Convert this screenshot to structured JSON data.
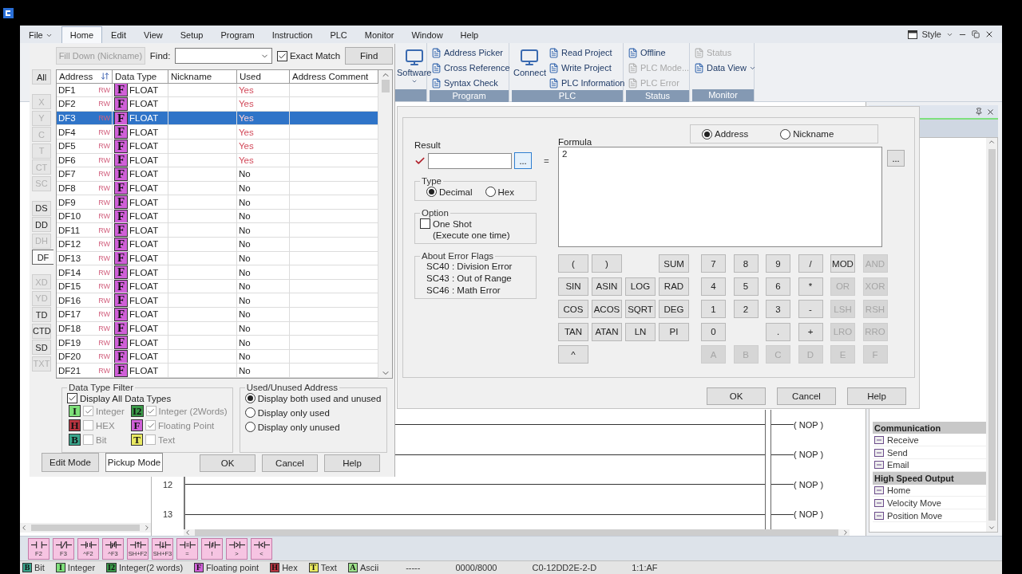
{
  "menu_bar": {
    "items": [
      {
        "label": "File",
        "caret": true,
        "selected": false
      },
      {
        "label": "Home",
        "caret": false,
        "selected": true
      },
      {
        "label": "Edit",
        "caret": false,
        "selected": false
      },
      {
        "label": "View",
        "caret": false,
        "selected": false
      },
      {
        "label": "Setup",
        "caret": false,
        "selected": false
      },
      {
        "label": "Program",
        "caret": false,
        "selected": false
      },
      {
        "label": "Instruction",
        "caret": false,
        "selected": false
      },
      {
        "label": "PLC",
        "caret": false,
        "selected": false
      },
      {
        "label": "Monitor",
        "caret": false,
        "selected": false
      },
      {
        "label": "Window",
        "caret": false,
        "selected": false
      },
      {
        "label": "Help",
        "caret": false,
        "selected": false
      }
    ],
    "style_label": "Style"
  },
  "ribbon": {
    "groups": [
      {
        "kind": "large",
        "items": [
          {
            "label": "Software",
            "caret": true,
            "disabled": false
          }
        ]
      },
      {
        "kind": "small",
        "title": "Program",
        "items": [
          {
            "label": "Address Picker",
            "caret": false,
            "disabled": false
          },
          {
            "label": "Cross Reference",
            "caret": false,
            "disabled": false
          },
          {
            "label": "Syntax Check",
            "caret": false,
            "disabled": false
          }
        ]
      },
      {
        "kind": "mixed",
        "title": "PLC",
        "items": [
          {
            "label": "Connect",
            "caret": false,
            "disabled": false
          },
          {
            "label": "Read Project",
            "caret": false,
            "disabled": false
          },
          {
            "label": "Write Project",
            "caret": false,
            "disabled": false
          },
          {
            "label": "PLC Information",
            "caret": false,
            "disabled": false
          }
        ]
      },
      {
        "kind": "small",
        "title": "Status",
        "items": [
          {
            "label": "Offline",
            "caret": false,
            "disabled": false
          },
          {
            "label": "PLC Mode...",
            "caret": false,
            "disabled": true
          },
          {
            "label": "PLC Error",
            "caret": false,
            "disabled": true
          }
        ]
      },
      {
        "kind": "small",
        "title": "Monitor",
        "items": [
          {
            "label": "Status",
            "caret": false,
            "disabled": true
          },
          {
            "label": "Data View",
            "caret": true,
            "disabled": false
          }
        ]
      }
    ]
  },
  "ladder": {
    "rungs": [
      {
        "output": "( NOP )"
      },
      {
        "output": "( NOP )"
      },
      {
        "number": "12",
        "output": "( NOP )"
      },
      {
        "number": "13",
        "output": "( NOP )"
      }
    ]
  },
  "instruction_list": {
    "items": [
      {
        "kind": "header",
        "label": "Communication"
      },
      {
        "kind": "item",
        "label": "Receive"
      },
      {
        "kind": "item",
        "label": "Send"
      },
      {
        "kind": "item",
        "label": "Email"
      },
      {
        "kind": "header",
        "label": "High Speed Output"
      },
      {
        "kind": "item",
        "label": "Home"
      },
      {
        "kind": "item",
        "label": "Velocity Move"
      },
      {
        "kind": "item",
        "label": "Position Move"
      }
    ]
  },
  "contact_toolbar": [
    {
      "kind": "no",
      "key": "F2"
    },
    {
      "kind": "nc",
      "key": "F3"
    },
    {
      "kind": "no_edge",
      "key": "^F2"
    },
    {
      "kind": "nc_edge",
      "key": "^F3"
    },
    {
      "kind": "rise",
      "key": "SH+F2"
    },
    {
      "kind": "fall",
      "key": "SH+F3"
    },
    {
      "kind": "eq",
      "key": "="
    },
    {
      "kind": "ne",
      "key": "!"
    },
    {
      "kind": "gt",
      "key": ">"
    },
    {
      "kind": "lt",
      "key": "<"
    }
  ],
  "status_bar": {
    "types": [
      {
        "badge": "B",
        "label": "Bit",
        "color": "#3aa58c"
      },
      {
        "badge": "I",
        "label": "Integer",
        "color": "#7ee07a"
      },
      {
        "badge": "I2",
        "label": "Integer(2 words)",
        "color": "#3a9a48"
      },
      {
        "badge": "F",
        "label": "Floating point",
        "color": "#d060d8"
      },
      {
        "badge": "H",
        "label": "Hex",
        "color": "#b83440"
      },
      {
        "badge": "T",
        "label": "Text",
        "color": "#eaea62"
      },
      {
        "badge": "A",
        "label": "Ascii",
        "color": "#9ee28a"
      }
    ],
    "fields": [
      "-----",
      "0000/8000",
      "C0-12DD2E-2-D",
      "1:1:AF"
    ]
  },
  "address_picker": {
    "fill_down": {
      "label": "Fill Down (Nickname)",
      "disabled": true
    },
    "find_label": "Find:",
    "exact_match": {
      "label": "Exact Match",
      "checked": true
    },
    "find_button": "Find",
    "type_groups": [
      {
        "buttons": [
          {
            "label": "All",
            "disabled": false,
            "selected": false
          }
        ]
      },
      {
        "buttons": [
          {
            "label": "X",
            "disabled": true,
            "selected": false
          },
          {
            "label": "Y",
            "disabled": true,
            "selected": false
          },
          {
            "label": "C",
            "disabled": true,
            "selected": false
          },
          {
            "label": "T",
            "disabled": true,
            "selected": false
          },
          {
            "label": "CT",
            "disabled": true,
            "selected": false
          },
          {
            "label": "SC",
            "disabled": true,
            "selected": false
          }
        ]
      },
      {
        "buttons": [
          {
            "label": "DS",
            "disabled": false,
            "selected": false
          },
          {
            "label": "DD",
            "disabled": false,
            "selected": false
          },
          {
            "label": "DH",
            "disabled": true,
            "selected": false
          },
          {
            "label": "DF",
            "disabled": false,
            "selected": true
          }
        ]
      },
      {
        "buttons": [
          {
            "label": "XD",
            "disabled": true,
            "selected": false
          },
          {
            "label": "YD",
            "disabled": true,
            "selected": false
          },
          {
            "label": "TD",
            "disabled": false,
            "selected": false
          },
          {
            "label": "CTD",
            "disabled": false,
            "selected": false
          },
          {
            "label": "SD",
            "disabled": false,
            "selected": false
          },
          {
            "label": "TXT",
            "disabled": true,
            "selected": false
          }
        ]
      }
    ],
    "columns": [
      "Address",
      "Data Type",
      "Nickname",
      "Used",
      "Address Comment"
    ],
    "rows": [
      {
        "address": "DF1",
        "access": "RW",
        "type_badge": "F",
        "data_type": "FLOAT",
        "used": "Yes",
        "in_use": true,
        "selected": false
      },
      {
        "address": "DF2",
        "access": "RW",
        "type_badge": "F",
        "data_type": "FLOAT",
        "used": "Yes",
        "in_use": true,
        "selected": false
      },
      {
        "address": "DF3",
        "access": "RW",
        "type_badge": "F",
        "data_type": "FLOAT",
        "used": "Yes",
        "in_use": true,
        "selected": true
      },
      {
        "address": "DF4",
        "access": "RW",
        "type_badge": "F",
        "data_type": "FLOAT",
        "used": "Yes",
        "in_use": true,
        "selected": false
      },
      {
        "address": "DF5",
        "access": "RW",
        "type_badge": "F",
        "data_type": "FLOAT",
        "used": "Yes",
        "in_use": true,
        "selected": false
      },
      {
        "address": "DF6",
        "access": "RW",
        "type_badge": "F",
        "data_type": "FLOAT",
        "used": "Yes",
        "in_use": true,
        "selected": false
      },
      {
        "address": "DF7",
        "access": "RW",
        "type_badge": "F",
        "data_type": "FLOAT",
        "used": "No",
        "in_use": false,
        "selected": false
      },
      {
        "address": "DF8",
        "access": "RW",
        "type_badge": "F",
        "data_type": "FLOAT",
        "used": "No",
        "in_use": false,
        "selected": false
      },
      {
        "address": "DF9",
        "access": "RW",
        "type_badge": "F",
        "data_type": "FLOAT",
        "used": "No",
        "in_use": false,
        "selected": false
      },
      {
        "address": "DF10",
        "access": "RW",
        "type_badge": "F",
        "data_type": "FLOAT",
        "used": "No",
        "in_use": false,
        "selected": false
      },
      {
        "address": "DF11",
        "access": "RW",
        "type_badge": "F",
        "data_type": "FLOAT",
        "used": "No",
        "in_use": false,
        "selected": false
      },
      {
        "address": "DF12",
        "access": "RW",
        "type_badge": "F",
        "data_type": "FLOAT",
        "used": "No",
        "in_use": false,
        "selected": false
      },
      {
        "address": "DF13",
        "access": "RW",
        "type_badge": "F",
        "data_type": "FLOAT",
        "used": "No",
        "in_use": false,
        "selected": false
      },
      {
        "address": "DF14",
        "access": "RW",
        "type_badge": "F",
        "data_type": "FLOAT",
        "used": "No",
        "in_use": false,
        "selected": false
      },
      {
        "address": "DF15",
        "access": "RW",
        "type_badge": "F",
        "data_type": "FLOAT",
        "used": "No",
        "in_use": false,
        "selected": false
      },
      {
        "address": "DF16",
        "access": "RW",
        "type_badge": "F",
        "data_type": "FLOAT",
        "used": "No",
        "in_use": false,
        "selected": false
      },
      {
        "address": "DF17",
        "access": "RW",
        "type_badge": "F",
        "data_type": "FLOAT",
        "used": "No",
        "in_use": false,
        "selected": false
      },
      {
        "address": "DF18",
        "access": "RW",
        "type_badge": "F",
        "data_type": "FLOAT",
        "used": "No",
        "in_use": false,
        "selected": false
      },
      {
        "address": "DF19",
        "access": "RW",
        "type_badge": "F",
        "data_type": "FLOAT",
        "used": "No",
        "in_use": false,
        "selected": false
      },
      {
        "address": "DF20",
        "access": "RW",
        "type_badge": "F",
        "data_type": "FLOAT",
        "used": "No",
        "in_use": false,
        "selected": false
      },
      {
        "address": "DF21",
        "access": "RW",
        "type_badge": "F",
        "data_type": "FLOAT",
        "used": "No",
        "in_use": false,
        "selected": false
      }
    ],
    "data_type_filter": {
      "title": "Data Type Filter",
      "display_all": {
        "label": "Display All Data Types",
        "checked": true
      },
      "types": [
        {
          "badge": "I",
          "label": "Integer",
          "checked": true,
          "color": "#7ee07a"
        },
        {
          "badge": "I2",
          "label": "Integer (2Words)",
          "checked": true,
          "color": "#3a9a48"
        },
        {
          "badge": "H",
          "label": "HEX",
          "checked": false,
          "color": "#b83440"
        },
        {
          "badge": "F",
          "label": "Floating Point",
          "checked": true,
          "color": "#d060d8"
        },
        {
          "badge": "B",
          "label": "Bit",
          "checked": false,
          "color": "#3aa58c"
        },
        {
          "badge": "T",
          "label": "Text",
          "checked": false,
          "color": "#eaea62"
        }
      ]
    },
    "used_filter": {
      "title": "Used/Unused Address",
      "options": [
        {
          "label": "Display both used and unused",
          "selected": true
        },
        {
          "label": "Display only used",
          "selected": false
        },
        {
          "label": "Display only unused",
          "selected": false
        }
      ]
    },
    "mode_buttons": [
      {
        "label": "Edit Mode",
        "selected": false
      },
      {
        "label": "Pickup Mode",
        "selected": true
      }
    ],
    "buttons": [
      "OK",
      "Cancel",
      "Help"
    ]
  },
  "formula_dialog": {
    "result_label": "Result",
    "result_browse": "...",
    "equals": "=",
    "formula_label": "Formula",
    "formula": "2",
    "formula_browse": "...",
    "name_mode": [
      {
        "label": "Address",
        "selected": true
      },
      {
        "label": "Nickname",
        "selected": false
      }
    ],
    "type": {
      "title": "Type",
      "options": [
        {
          "label": "Decimal",
          "selected": true
        },
        {
          "label": "Hex",
          "selected": false
        }
      ]
    },
    "option": {
      "title": "Option",
      "one_shot": {
        "label": "One Shot",
        "note": "(Execute one time)",
        "checked": false
      }
    },
    "error_flags": {
      "title": "About Error Flags",
      "lines": [
        "SC40 : Division Error",
        "SC43 : Out of Range",
        "SC46 : Math Error"
      ]
    },
    "keypad": [
      [
        {
          "kind": "key",
          "label": "(",
          "disabled": false
        },
        {
          "kind": "key",
          "label": ")",
          "disabled": false
        },
        {
          "kind": "gap"
        },
        {
          "kind": "key",
          "label": "SUM",
          "disabled": false
        },
        {
          "kind": "key",
          "label": "7",
          "disabled": false
        },
        {
          "kind": "key",
          "label": "8",
          "disabled": false
        },
        {
          "kind": "key",
          "label": "9",
          "disabled": false
        },
        {
          "kind": "key",
          "label": "/",
          "disabled": false
        },
        {
          "kind": "key",
          "label": "MOD",
          "disabled": false
        },
        {
          "kind": "key",
          "label": "AND",
          "disabled": true
        }
      ],
      [
        {
          "kind": "key",
          "label": "SIN",
          "disabled": false
        },
        {
          "kind": "key",
          "label": "ASIN",
          "disabled": false
        },
        {
          "kind": "key",
          "label": "LOG",
          "disabled": false
        },
        {
          "kind": "key",
          "label": "RAD",
          "disabled": false
        },
        {
          "kind": "key",
          "label": "4",
          "disabled": false
        },
        {
          "kind": "key",
          "label": "5",
          "disabled": false
        },
        {
          "kind": "key",
          "label": "6",
          "disabled": false
        },
        {
          "kind": "key",
          "label": "*",
          "disabled": false
        },
        {
          "kind": "key",
          "label": "OR",
          "disabled": true
        },
        {
          "kind": "key",
          "label": "XOR",
          "disabled": true
        }
      ],
      [
        {
          "kind": "key",
          "label": "COS",
          "disabled": false
        },
        {
          "kind": "key",
          "label": "ACOS",
          "disabled": false
        },
        {
          "kind": "key",
          "label": "SQRT",
          "disabled": false
        },
        {
          "kind": "key",
          "label": "DEG",
          "disabled": false
        },
        {
          "kind": "key",
          "label": "1",
          "disabled": false
        },
        {
          "kind": "key",
          "label": "2",
          "disabled": false
        },
        {
          "kind": "key",
          "label": "3",
          "disabled": false
        },
        {
          "kind": "key",
          "label": "-",
          "disabled": false
        },
        {
          "kind": "key",
          "label": "LSH",
          "disabled": true
        },
        {
          "kind": "key",
          "label": "RSH",
          "disabled": true
        }
      ],
      [
        {
          "kind": "key",
          "label": "TAN",
          "disabled": false
        },
        {
          "kind": "key",
          "label": "ATAN",
          "disabled": false
        },
        {
          "kind": "key",
          "label": "LN",
          "disabled": false
        },
        {
          "kind": "key",
          "label": "PI",
          "disabled": false
        },
        {
          "kind": "key",
          "label": "0",
          "disabled": false
        },
        {
          "kind": "gap"
        },
        {
          "kind": "key",
          "label": ".",
          "disabled": false
        },
        {
          "kind": "key",
          "label": "+",
          "disabled": false
        },
        {
          "kind": "key",
          "label": "LRO",
          "disabled": true
        },
        {
          "kind": "key",
          "label": "RRO",
          "disabled": true
        }
      ],
      [
        {
          "kind": "key",
          "label": "^",
          "disabled": false
        },
        {
          "kind": "gap"
        },
        {
          "kind": "gap"
        },
        {
          "kind": "gap"
        },
        {
          "kind": "key",
          "label": "A",
          "disabled": true
        },
        {
          "kind": "key",
          "label": "B",
          "disabled": true
        },
        {
          "kind": "key",
          "label": "C",
          "disabled": true
        },
        {
          "kind": "key",
          "label": "D",
          "disabled": true
        },
        {
          "kind": "key",
          "label": "E",
          "disabled": true
        },
        {
          "kind": "key",
          "label": "F",
          "disabled": true
        }
      ]
    ],
    "buttons": [
      "OK",
      "Cancel",
      "Help"
    ]
  }
}
